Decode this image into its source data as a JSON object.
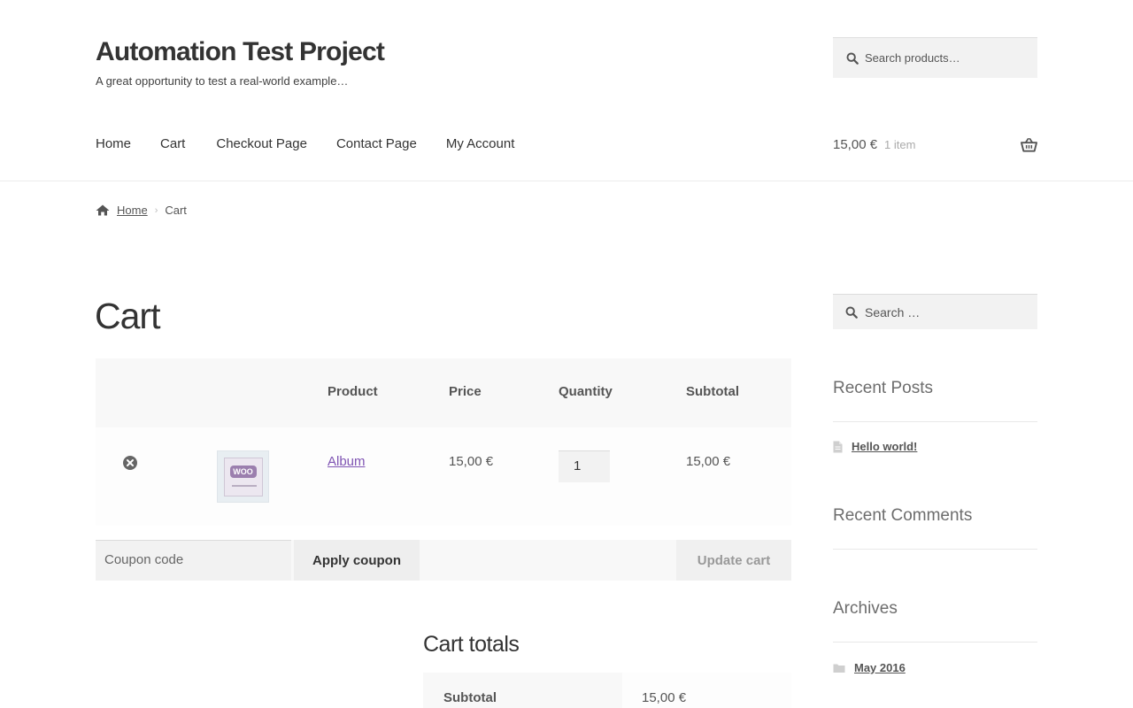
{
  "site": {
    "title": "Automation Test Project",
    "tagline": "A great opportunity to test a real-world example…"
  },
  "header_search": {
    "placeholder": "Search products…"
  },
  "nav": [
    "Home",
    "Cart",
    "Checkout Page",
    "Contact Page",
    "My Account"
  ],
  "mini_cart": {
    "amount": "15,00 €",
    "count": "1 item"
  },
  "breadcrumb": {
    "home": "Home",
    "current": "Cart"
  },
  "page_title": "Cart",
  "cart": {
    "headers": {
      "product": "Product",
      "price": "Price",
      "quantity": "Quantity",
      "subtotal": "Subtotal"
    },
    "items": [
      {
        "name": "Album",
        "price": "15,00 €",
        "quantity": "1",
        "subtotal": "15,00 €",
        "thumb_label": "WOO"
      }
    ],
    "coupon_placeholder": "Coupon code",
    "apply_label": "Apply coupon",
    "update_label": "Update cart"
  },
  "totals": {
    "title": "Cart totals",
    "subtotal_label": "Subtotal",
    "subtotal_value": "15,00 €"
  },
  "sidebar": {
    "search_placeholder": "Search …",
    "recent_posts_title": "Recent Posts",
    "recent_posts": [
      "Hello world!"
    ],
    "recent_comments_title": "Recent Comments",
    "archives_title": "Archives",
    "archives": [
      "May 2016"
    ]
  },
  "colors": {
    "accent_link": "#7f54b3",
    "text": "#333333",
    "muted": "#6d6d6d"
  }
}
